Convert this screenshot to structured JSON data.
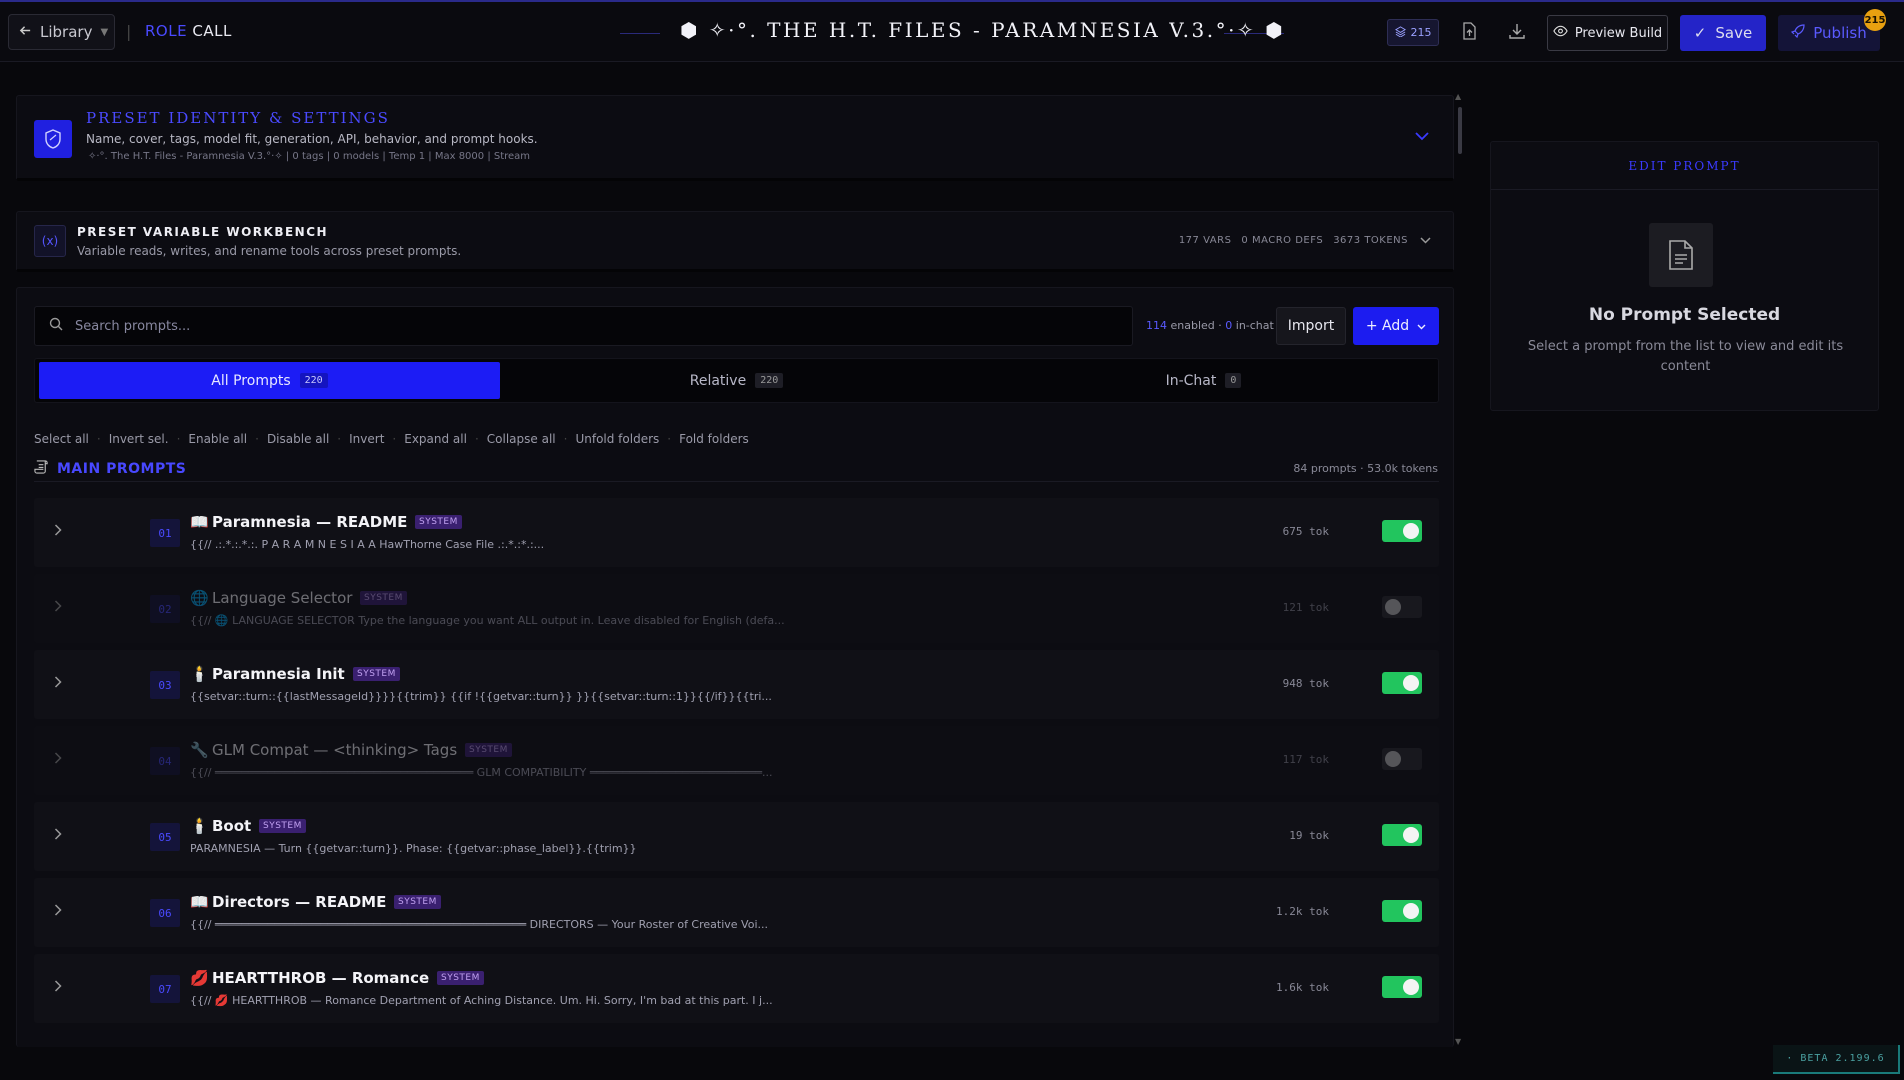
{
  "topbar": {
    "library_label": "Library",
    "brand_role": "ROLE",
    "brand_call": "CALL",
    "title": "✧·°. THE H.T. FILES - PARAMNESIA V.3.°·✧",
    "token_badge": "215",
    "preview_label": "Preview Build",
    "save_label": "Save",
    "publish_label": "Publish",
    "publish_badge": "215"
  },
  "identity": {
    "title": "PRESET IDENTITY & SETTINGS",
    "description": "Name, cover, tags, model fit, generation, API, behavior, and prompt hooks.",
    "meta": "✧·°. The H.T. Files - Paramnesia V.3.°·✧ | 0 tags | 0 models | Temp 1 | Max 8000 | Stream"
  },
  "workbench": {
    "icon_label": "(x)",
    "title": "PRESET VARIABLE WORKBENCH",
    "description": "Variable reads, writes, and rename tools across preset prompts.",
    "vars": "177 VARS",
    "macros": "0 MACRO DEFS",
    "tokens": "3673 TOKENS"
  },
  "list": {
    "search_placeholder": "Search prompts...",
    "enabled_count": "114",
    "enabled_label": "enabled ·",
    "inchat_count": "0",
    "inchat_label": "in-chat",
    "import_label": "Import",
    "add_label": "+ Add",
    "tabs": [
      {
        "label": "All Prompts",
        "count": "220"
      },
      {
        "label": "Relative",
        "count": "220"
      },
      {
        "label": "In-Chat",
        "count": "0"
      }
    ],
    "actions": [
      "Select all",
      "Invert sel.",
      "Enable all",
      "Disable all",
      "Invert",
      "Expand all",
      "Collapse all",
      "Unfold folders",
      "Fold folders"
    ],
    "section_title": "MAIN PROMPTS",
    "section_stats": "84 prompts · 53.0k tokens",
    "system_tag": "SYSTEM",
    "rows": [
      {
        "num": "01",
        "emoji": "📖",
        "name": "Paramnesia — README",
        "preview": "{{// .:.*.:.*.:. P A R A M N E S I A A HawThorne Case File .:.*.:*.:...",
        "tokens": "675 tok",
        "enabled": true
      },
      {
        "num": "02",
        "emoji": "🌐",
        "name": "Language Selector",
        "preview": "{{// 🌐 LANGUAGE SELECTOR Type the language you want ALL output in. Leave disabled for English (defa...",
        "tokens": "121 tok",
        "enabled": false
      },
      {
        "num": "03",
        "emoji": "🕯️",
        "name": "Paramnesia Init",
        "preview": "{{setvar::turn::{{lastMessageId}}}}{{trim}} {{if !{{getvar::turn}} }}{{setvar::turn::1}}{{/if}}{{tri...",
        "tokens": "948 tok",
        "enabled": true
      },
      {
        "num": "04",
        "emoji": "🔧",
        "name": "GLM Compat — <thinking> Tags",
        "preview": "{{// ═══════════════════════════════════════ GLM COMPATIBILITY ══════════════════════════...",
        "tokens": "117 tok",
        "enabled": false
      },
      {
        "num": "05",
        "emoji": "🕯️",
        "name": "Boot",
        "preview": "PARAMNESIA — Turn {{getvar::turn}}. Phase: {{getvar::phase_label}}.{{trim}}",
        "tokens": "19 tok",
        "enabled": true
      },
      {
        "num": "06",
        "emoji": "📖",
        "name": "Directors — README",
        "preview": "{{// ═══════════════════════════════════════════════ DIRECTORS — Your Roster of Creative Voi...",
        "tokens": "1.2k tok",
        "enabled": true
      },
      {
        "num": "07",
        "emoji": "💋",
        "name": "HEARTTHROB — Romance",
        "preview": "{{// 💋 HEARTTHROB — Romance Department of Aching Distance. Um. Hi. Sorry, I'm bad at this part. I j...",
        "tokens": "1.6k tok",
        "enabled": true
      }
    ]
  },
  "edit": {
    "title": "EDIT PROMPT",
    "empty_title": "No Prompt Selected",
    "empty_sub": "Select a prompt from the list to view and edit its content"
  },
  "version": "· BETA 2.199.6",
  "colors": {
    "accent": "#1c1cf5",
    "toggle_on": "#22c55e",
    "badge": "#e8a010"
  }
}
